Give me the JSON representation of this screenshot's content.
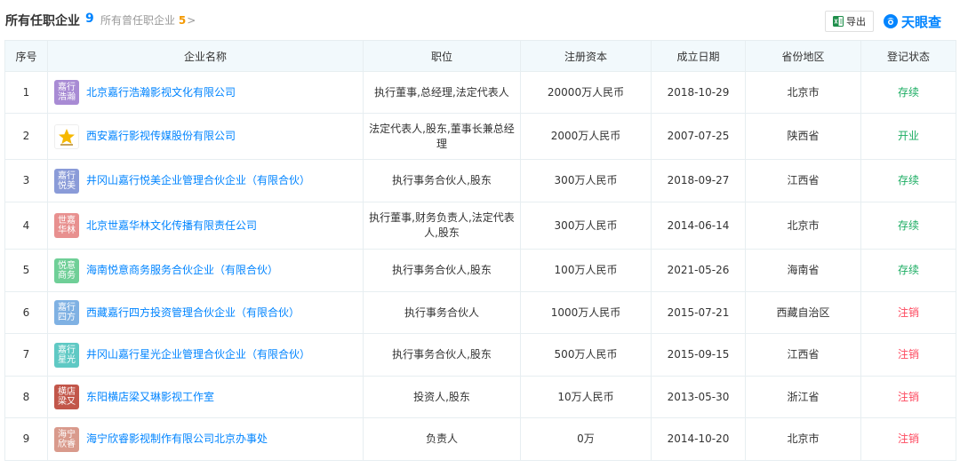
{
  "header": {
    "title": "所有任职企业",
    "count": "9",
    "past_label": "所有曾任职企业",
    "past_count": "5",
    "chevron": ">",
    "export_label": "导出",
    "brand": "天眼查"
  },
  "colors": {
    "accent": "#0084ff",
    "status_active": "#1cad63",
    "status_cancelled": "#fd485e",
    "header_bg": "#f2f9fc"
  },
  "table": {
    "columns": [
      "序号",
      "企业名称",
      "职位",
      "注册资本",
      "成立日期",
      "省份地区",
      "登记状态"
    ],
    "rows": [
      {
        "no": "1",
        "logo": "嘉行浩瀚",
        "logo_color": "#a88bd4",
        "name": "北京嘉行浩瀚影视文化有限公司",
        "position": "执行董事,总经理,法定代表人",
        "capital": "20000万人民币",
        "date": "2018-10-29",
        "region": "北京市",
        "status": "存续",
        "status_type": "ok"
      },
      {
        "no": "2",
        "logo": "",
        "logo_color": "",
        "name": "西安嘉行影视传媒股份有限公司",
        "position": "法定代表人,股东,董事长兼总经理",
        "capital": "2000万人民币",
        "date": "2007-07-25",
        "region": "陕西省",
        "status": "开业",
        "status_type": "ok"
      },
      {
        "no": "3",
        "logo": "嘉行悦美",
        "logo_color": "#8a9bd8",
        "name": "井冈山嘉行悦美企业管理合伙企业（有限合伙）",
        "position": "执行事务合伙人,股东",
        "capital": "300万人民币",
        "date": "2018-09-27",
        "region": "江西省",
        "status": "存续",
        "status_type": "ok"
      },
      {
        "no": "4",
        "logo": "世嘉华林",
        "logo_color": "#e8908f",
        "name": "北京世嘉华林文化传播有限责任公司",
        "position": "执行董事,财务负责人,法定代表人,股东",
        "capital": "300万人民币",
        "date": "2014-06-14",
        "region": "北京市",
        "status": "存续",
        "status_type": "ok"
      },
      {
        "no": "5",
        "logo": "悦意商务",
        "logo_color": "#6fcf97",
        "name": "海南悦意商务服务合伙企业（有限合伙）",
        "position": "执行事务合伙人,股东",
        "capital": "100万人民币",
        "date": "2021-05-26",
        "region": "海南省",
        "status": "存续",
        "status_type": "ok"
      },
      {
        "no": "6",
        "logo": "嘉行四方",
        "logo_color": "#7fb1e3",
        "name": "西藏嘉行四方投资管理合伙企业（有限合伙）",
        "position": "执行事务合伙人",
        "capital": "1000万人民币",
        "date": "2015-07-21",
        "region": "西藏自治区",
        "status": "注销",
        "status_type": "off"
      },
      {
        "no": "7",
        "logo": "嘉行星光",
        "logo_color": "#5fc9c4",
        "name": "井冈山嘉行星光企业管理合伙企业（有限合伙）",
        "position": "执行事务合伙人,股东",
        "capital": "500万人民币",
        "date": "2015-09-15",
        "region": "江西省",
        "status": "注销",
        "status_type": "off"
      },
      {
        "no": "8",
        "logo": "横店梁又",
        "logo_color": "#c2564a",
        "name": "东阳横店梁又琳影视工作室",
        "position": "投资人,股东",
        "capital": "10万人民币",
        "date": "2013-05-30",
        "region": "浙江省",
        "status": "注销",
        "status_type": "off"
      },
      {
        "no": "9",
        "logo": "海宁欣睿",
        "logo_color": "#d99a8c",
        "name": "海宁欣睿影视制作有限公司北京办事处",
        "position": "负责人",
        "capital": "0万",
        "date": "2014-10-20",
        "region": "北京市",
        "status": "注销",
        "status_type": "off"
      }
    ]
  }
}
